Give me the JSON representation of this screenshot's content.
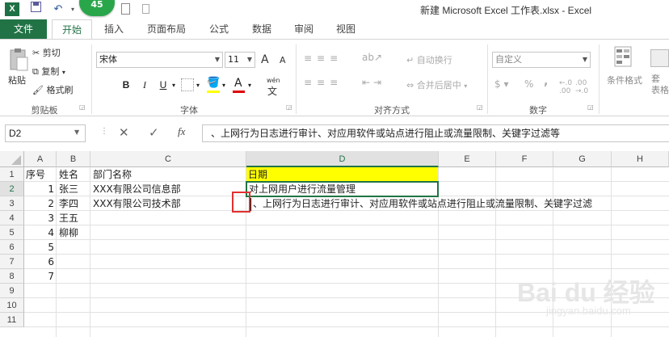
{
  "window": {
    "title": "新建 Microsoft Excel 工作表.xlsx - Excel",
    "app_icon": "X",
    "badge": "45"
  },
  "tabs": [
    "文件",
    "开始",
    "插入",
    "页面布局",
    "公式",
    "数据",
    "审阅",
    "视图"
  ],
  "ribbon": {
    "clipboard": {
      "paste": "粘贴",
      "cut": "剪切",
      "copy": "复制",
      "format_painter": "格式刷",
      "label": "剪贴板"
    },
    "font": {
      "name": "宋体",
      "size": "11",
      "label": "字体",
      "bold": "B",
      "italic": "I",
      "underline": "U",
      "grow": "A",
      "shrink": "A",
      "phonetic": "wén",
      "font_color": "A"
    },
    "alignment": {
      "wrap": "自动换行",
      "merge": "合并后居中",
      "label": "对齐方式"
    },
    "number": {
      "format": "自定义",
      "label": "数字",
      "currency": "$",
      "percent": "%",
      "comma": ","
    },
    "styles": {
      "conditional": "条件格式",
      "table": "套\n表格"
    }
  },
  "formula_bar": {
    "name_box": "D2",
    "cancel": "✕",
    "enter": "✓",
    "fx": "fx",
    "value": "、上网行为日志进行审计、对应用软件或站点进行阻止或流量限制、关键字过滤等"
  },
  "grid": {
    "columns": [
      "A",
      "B",
      "C",
      "D",
      "E",
      "F",
      "G",
      "H"
    ],
    "rows": [
      "1",
      "2",
      "3",
      "4",
      "5",
      "6",
      "7",
      "8",
      "9",
      "10",
      "11"
    ],
    "cells": {
      "A1": "序号",
      "B1": "姓名",
      "C1": "部门名称",
      "D1": "日期",
      "A2": "1",
      "B2": "张三",
      "C2": "XXX有限公司信息部",
      "D2": "对上网用户进行流量管理",
      "A3": "2",
      "B3": "李四",
      "C3": "XXX有限公司技术部",
      "D3": "、上网行为日志进行审计、对应用软件或站点进行阻止或流量限制、关键字过滤",
      "A4": "3",
      "B4": "王五",
      "A5": "4",
      "B5": "柳柳",
      "A6": "5",
      "A7": "6",
      "A8": "7"
    }
  },
  "watermark": {
    "brand": "Bai du 经验",
    "url": "jingyan.baidu.com"
  },
  "colors": {
    "excel_green": "#217346",
    "highlight_yellow": "#ffff00",
    "red_box": "#e23030"
  }
}
